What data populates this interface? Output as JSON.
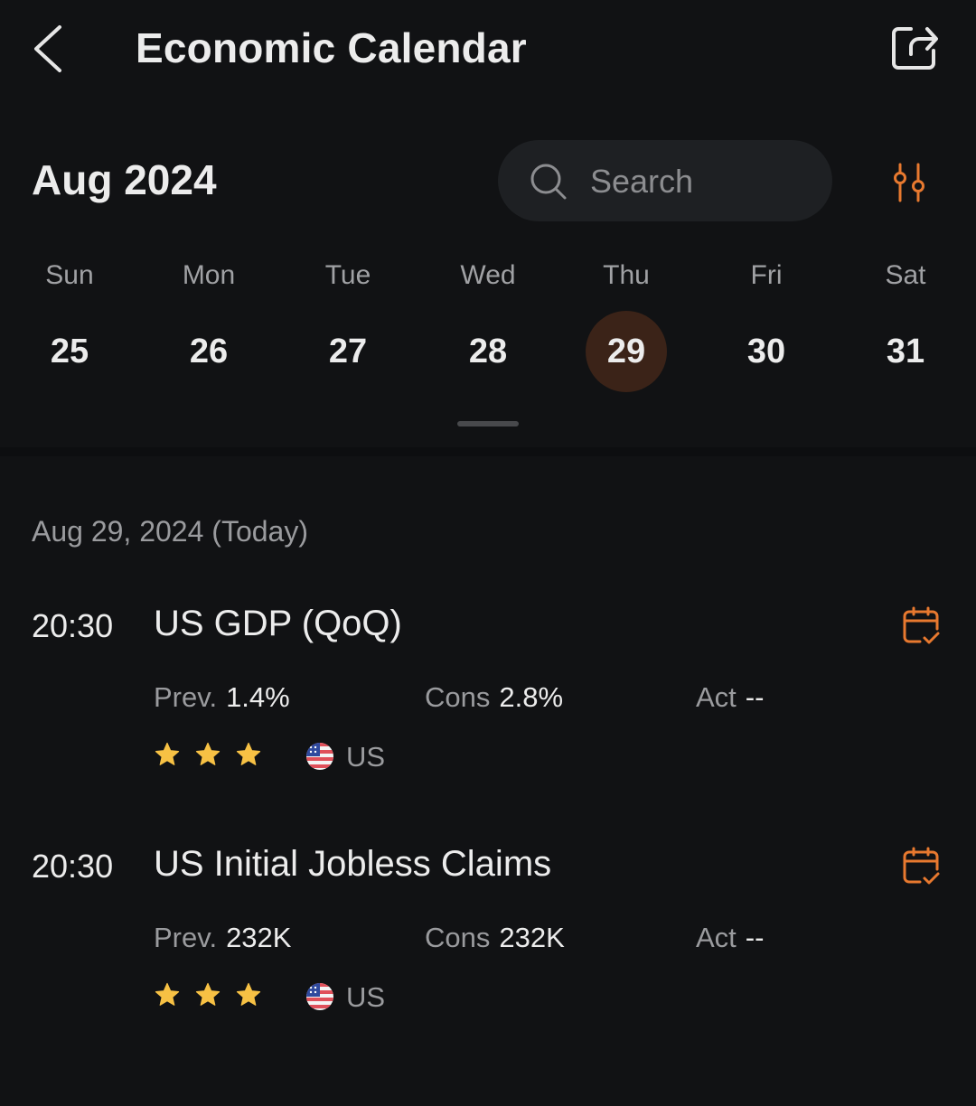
{
  "header": {
    "title": "Economic Calendar",
    "back_icon": "chevron-left-icon",
    "share_icon": "share-icon"
  },
  "toolbar": {
    "month": "Aug 2024",
    "search_placeholder": "Search",
    "search_value": "",
    "filter_icon": "sliders-icon"
  },
  "week": {
    "selected_index": 4,
    "days": [
      {
        "name": "Sun",
        "num": "25"
      },
      {
        "name": "Mon",
        "num": "26"
      },
      {
        "name": "Tue",
        "num": "27"
      },
      {
        "name": "Wed",
        "num": "28"
      },
      {
        "name": "Thu",
        "num": "29"
      },
      {
        "name": "Fri",
        "num": "30"
      },
      {
        "name": "Sat",
        "num": "31"
      }
    ]
  },
  "list": {
    "date_heading": "Aug 29, 2024 (Today)",
    "events": [
      {
        "time": "20:30",
        "name": "US GDP (QoQ)",
        "prev_label": "Prev.",
        "prev": "1.4%",
        "cons_label": "Cons",
        "cons": "2.8%",
        "act_label": "Act",
        "act": "--",
        "importance_stars": 3,
        "importance_max": 3,
        "country": "US",
        "flag_icon": "us-flag-icon"
      },
      {
        "time": "20:30",
        "name": "US Initial Jobless Claims",
        "prev_label": "Prev.",
        "prev": "232K",
        "cons_label": "Cons",
        "cons": "232K",
        "act_label": "Act",
        "act": "--",
        "importance_stars": 3,
        "importance_max": 3,
        "country": "US",
        "flag_icon": "us-flag-icon"
      }
    ]
  },
  "colors": {
    "background": "#111214",
    "accent": "#e8792f",
    "selected_day_bg": "#3b2318",
    "star": "#f7c144",
    "search_bg": "#1e2023"
  }
}
